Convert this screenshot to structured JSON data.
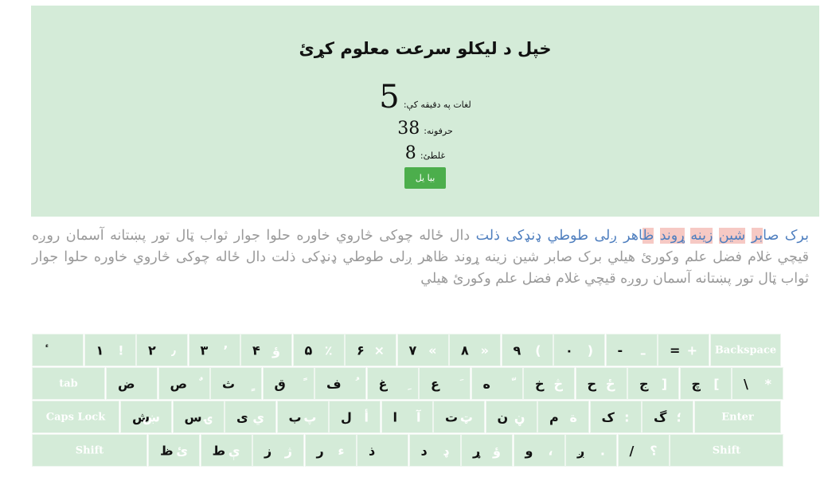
{
  "result": {
    "title": "خپل د ليکلو سرعت معلوم کړئ",
    "wpm_label": "لغات په دقيقه کې:",
    "wpm": "5",
    "chars_label": "حرفونه:",
    "chars": "38",
    "errors_label": "غلطئ:",
    "errors": "8",
    "again_label": "بیا یل"
  },
  "passage": {
    "typed_1": "برک صا",
    "typed_1b": "بر",
    "typed_2": " ",
    "typed_3": "شين",
    "typed_3b": " ",
    "typed_4": "زينه",
    "typed_4b": " ",
    "typed_5": "ړون",
    "typed_6": "د",
    "typed_6b": " ",
    "typed_7": "ظ",
    "typed_7b": "اهر ږلی طوطي ډنډکی ذلت",
    "remaining": " دال ځاله چوکی څاروي خاوره حلوا جوار ثواب ټال تور پښتانه آسمان روږه قيچي غلام فضل علم وکورئ هيلي برک صابر شين زينه ړوند ظاهر ږلی طوطي ډنډکی ذلت دال ځاله چوکی څاروي خاوره حلوا جوار ثواب ټال تور پښتانه آسمان روږه قيچي غلام فضل علم وکورئ هيلي"
  },
  "keyboard": {
    "row1": [
      {
        "l": "ٔ",
        "r": ""
      },
      {
        "l": "۱",
        "r": "!"
      },
      {
        "l": "۲",
        "r": "٫"
      },
      {
        "l": "۳",
        "r": "٬"
      },
      {
        "l": "۴",
        "r": "ؤ"
      },
      {
        "l": "۵",
        "r": "٪"
      },
      {
        "l": "۶",
        "r": "×"
      },
      {
        "l": "۷",
        "r": "«"
      },
      {
        "l": "۸",
        "r": "»"
      },
      {
        "l": "۹",
        "r": "("
      },
      {
        "l": "۰",
        "r": ")"
      },
      {
        "l": "-",
        "r": "ـ"
      },
      {
        "l": "=",
        "r": "+"
      }
    ],
    "backspace": "Backspace",
    "tab": "tab",
    "row2": [
      {
        "l": "ض",
        "r": ""
      },
      {
        "l": "ص",
        "r": "ٌ"
      },
      {
        "l": "ث",
        "r": "ٍ"
      },
      {
        "l": "ق",
        "r": "ً"
      },
      {
        "l": "ف",
        "r": "ُ"
      },
      {
        "l": "غ",
        "r": "ِ"
      },
      {
        "l": "ع",
        "r": "َ"
      },
      {
        "l": "ه",
        "r": "ّ"
      },
      {
        "l": "خ",
        "r": "څ"
      },
      {
        "l": "ح",
        "r": "ځ"
      },
      {
        "l": "ج",
        "r": "]"
      },
      {
        "l": "چ",
        "r": "["
      },
      {
        "l": "\\",
        "r": "*"
      }
    ],
    "caps": "Caps Lock",
    "row3": [
      {
        "l": "ش",
        "r": "ښ"
      },
      {
        "l": "س",
        "r": "ۍ"
      },
      {
        "l": "ی",
        "r": "ي"
      },
      {
        "l": "ب",
        "r": "پ"
      },
      {
        "l": "ل",
        "r": "أ"
      },
      {
        "l": "ا",
        "r": "آ"
      },
      {
        "l": "ت",
        "r": "ټ"
      },
      {
        "l": "ن",
        "r": "ڼ"
      },
      {
        "l": "م",
        "r": "ة"
      },
      {
        "l": "ک",
        "r": ":"
      },
      {
        "l": "گ",
        "r": "؛"
      }
    ],
    "enter": "Enter",
    "shift_left": "Shift",
    "row4": [
      {
        "l": "ظ",
        "r": "ئ"
      },
      {
        "l": "ط",
        "r": "ې"
      },
      {
        "l": "ز",
        "r": "ژ"
      },
      {
        "l": "ر",
        "r": "ء"
      },
      {
        "l": "ذ",
        "r": ""
      },
      {
        "l": "د",
        "r": "ډ"
      },
      {
        "l": "ړ",
        "r": "ؤ"
      },
      {
        "l": "و",
        "r": "،"
      },
      {
        "l": "ږ",
        "r": "."
      },
      {
        "l": "/",
        "r": "؟"
      }
    ],
    "shift_right": "Shift"
  }
}
